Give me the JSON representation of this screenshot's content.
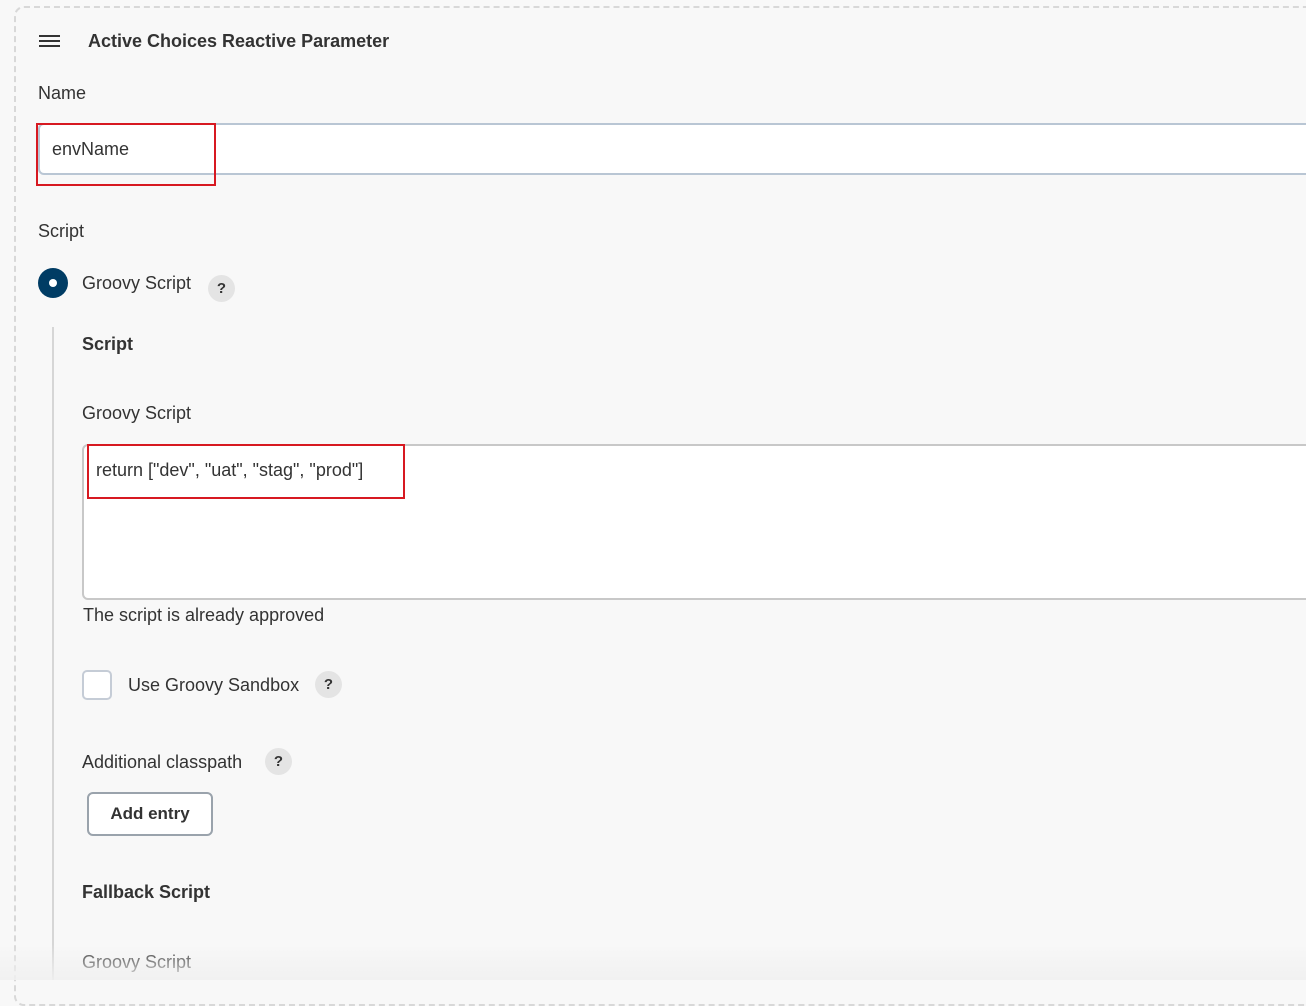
{
  "panel": {
    "title": "Active Choices Reactive Parameter",
    "name_label": "Name",
    "name_value": "envName",
    "script_label": "Script",
    "groovy_option_label": "Groovy Script",
    "help_glyph": "?"
  },
  "script_section": {
    "heading": "Script",
    "groovy_script_label": "Groovy Script",
    "groovy_script_value": "return [\"dev\", \"uat\", \"stag\", \"prod\"]",
    "approval_text": "The script is already approved",
    "sandbox_label": "Use Groovy Sandbox",
    "classpath_label": "Additional classpath",
    "add_entry_label": "Add entry"
  },
  "fallback_section": {
    "heading": "Fallback Script",
    "groovy_script_label": "Groovy Script"
  },
  "colors": {
    "highlight": "#d71921",
    "radio_selected": "#003c64",
    "background": "#f8f8f8"
  }
}
